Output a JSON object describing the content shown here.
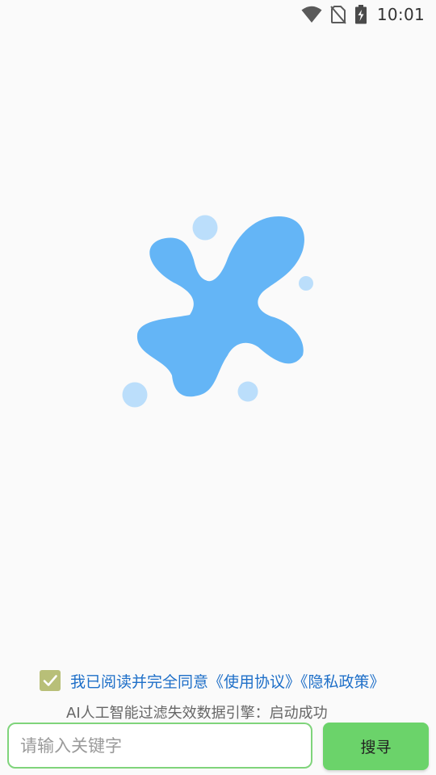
{
  "status_bar": {
    "time": "10:01",
    "icons": [
      "wifi-icon",
      "no-sim-icon",
      "battery-charging-icon"
    ]
  },
  "logo": {
    "name": "splash-logo",
    "colors": {
      "blob": "#64b5f6",
      "bubbles": "#bbdefb"
    }
  },
  "consent": {
    "checked": true,
    "text": "我已阅读并完全同意《使用协议》《隐私政策》"
  },
  "engine_status": "AI人工智能过滤失效数据引擎：启动成功",
  "search": {
    "placeholder": "请输入关键字",
    "value": "",
    "button_label": "搜寻"
  },
  "colors": {
    "accent_green": "#6bd36a",
    "input_border": "#7fd47b",
    "link_blue": "#1e6fc8",
    "checkbox": "#b8bf78"
  }
}
